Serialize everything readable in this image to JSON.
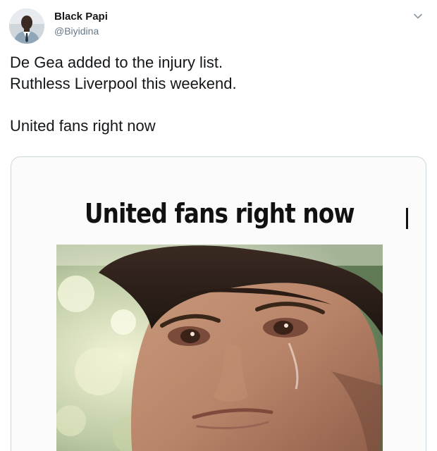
{
  "author": {
    "display_name": "Black Papi",
    "handle": "@Biyidina"
  },
  "tweet": {
    "line1": "De Gea added to the injury list.",
    "line2": "Ruthless Liverpool this weekend.",
    "line3": "United fans right now"
  },
  "media": {
    "caption": "United fans right now"
  },
  "icons": {
    "menu": "chevron-down-icon"
  },
  "colors": {
    "text": "#14171a",
    "secondary": "#657786",
    "border": "#ccd6dd"
  }
}
